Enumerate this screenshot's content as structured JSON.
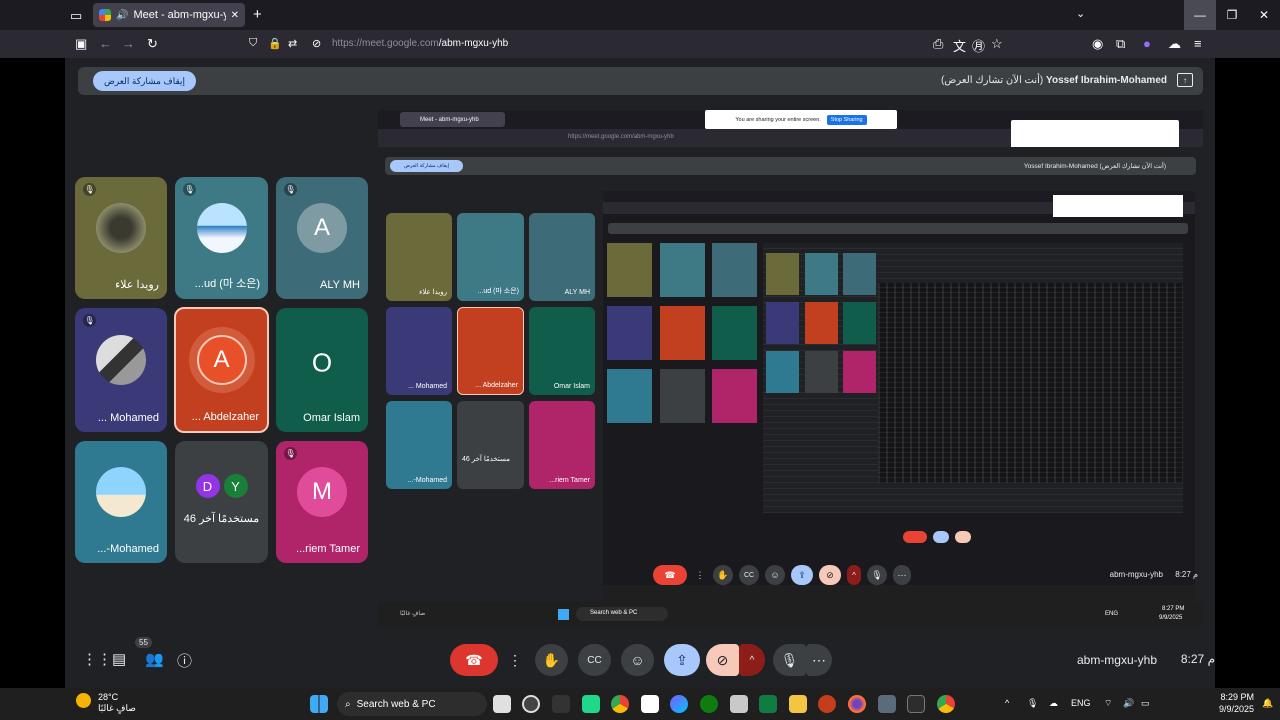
{
  "browser": {
    "tab_title": "Meet - abm-mgxu-yhb",
    "url_host": "https://meet.google.com",
    "url_path": "/abm-mgxu-yhb"
  },
  "meet": {
    "stop_presenting_label": "إيقاف مشاركة العرض",
    "presenter_name": "Yossef Ibrahim-Mohamed",
    "presenter_status": "(أنت الآن تشارك العرض)",
    "participants": [
      {
        "name": "رويدا علاء",
        "type": "photo",
        "muted": true
      },
      {
        "name": "...ud (마 소은)",
        "type": "photo",
        "muted": true
      },
      {
        "name": "ALY MH",
        "type": "letter",
        "letter": "A",
        "muted": true
      },
      {
        "name": "... Mohamed",
        "type": "photo",
        "muted": true
      },
      {
        "name": "... Abdelzaher",
        "type": "letter",
        "letter": "A",
        "muted": false
      },
      {
        "name": "Omar Islam",
        "type": "letter",
        "letter": "O",
        "muted": false
      },
      {
        "name": "...-Mohamed",
        "type": "photo",
        "muted": false
      },
      {
        "name": "46 مستخدمًا آخر",
        "type": "others",
        "letters": [
          "D",
          "Y"
        ],
        "muted": false
      },
      {
        "name": "...riem Tamer",
        "type": "letter",
        "letter": "M",
        "muted": true
      }
    ],
    "chat_badge": "55",
    "meeting_code": "abm-mgxu-yhb",
    "time": "8:27 م"
  },
  "shared_screen": {
    "tab_title": "Meet - abm-mgxu-yhb",
    "banner_text": "You are sharing your entire screen.",
    "banner_stop": "Stop Sharing",
    "url": "https://meet.google.com/abm-mgxu-yhb",
    "stop_label": "إيقاف مشاركة العرض",
    "presenter": "Yossef Ibrahim-Mohamed (أنت الآن تشارك العرض)",
    "meeting_code": "abm-mgxu-yhb",
    "time": "8:27 م",
    "taskbar_search": "Search web & PC",
    "taskbar_time": "8:27 PM",
    "taskbar_date": "9/9/2025",
    "lang": "ENG",
    "weather": "صافٍ غالبًا",
    "inner_participants": [
      "رويدا علاء",
      "...ud (마 소은)",
      "ALY MH",
      "... Mohamed",
      "... Abdelzaher",
      "Omar Islam",
      "...-Mohamed",
      "46 مستخدمًا آخر",
      "...riem Tamer"
    ]
  },
  "taskbar": {
    "temperature": "28°C",
    "weather": "صافٍ غالبًا",
    "search_placeholder": "Search web & PC",
    "lang": "ENG",
    "time": "8:29 PM",
    "date": "9/9/2025"
  },
  "colors": {
    "accent_red": "#ea4335",
    "accent_blue": "#a8c7fa",
    "meet_bg": "#202124"
  }
}
